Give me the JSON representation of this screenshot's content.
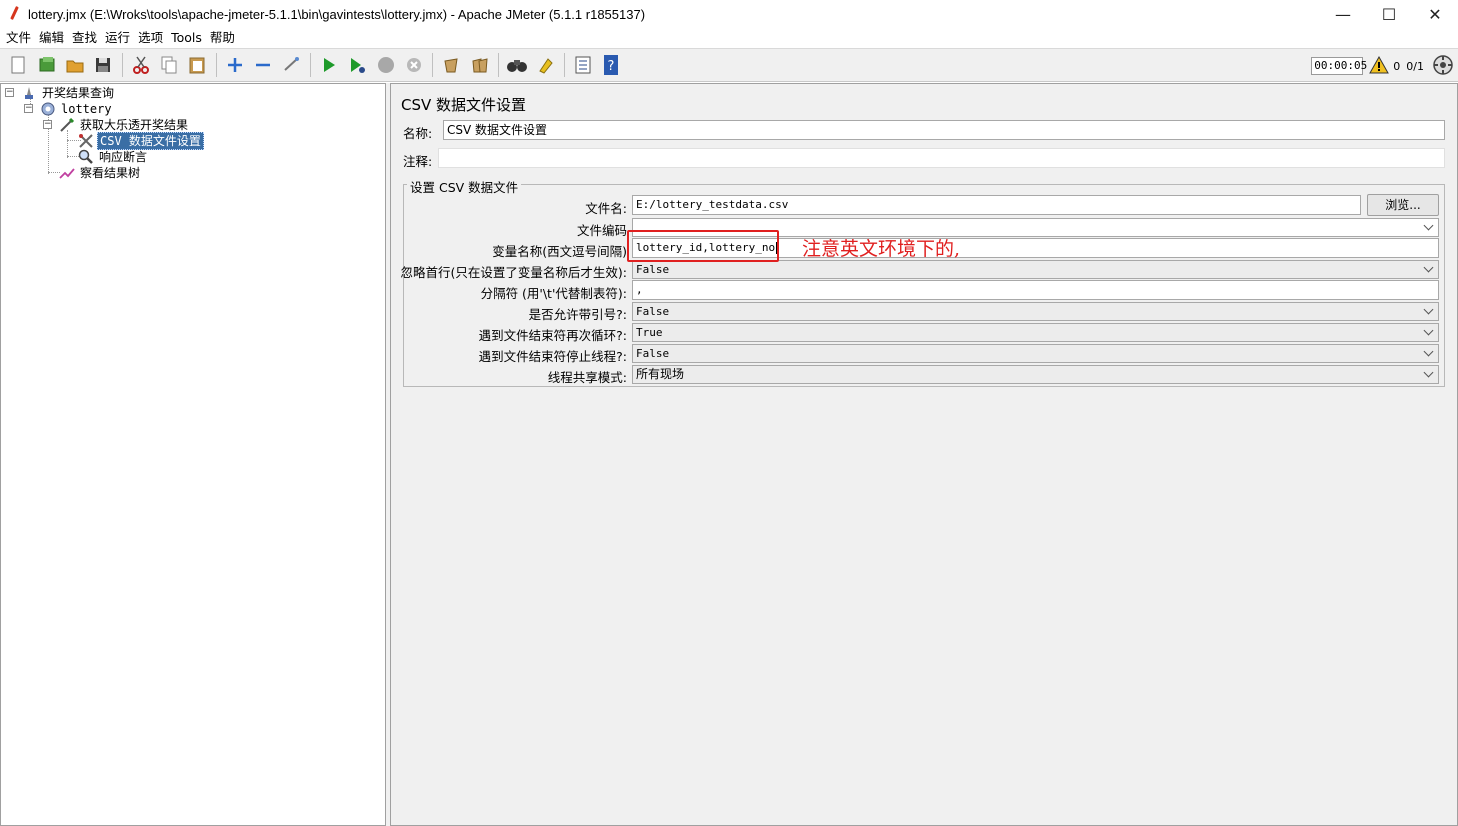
{
  "window": {
    "title": "lottery.jmx (E:\\Wroks\\tools\\apache-jmeter-5.1.1\\bin\\gavintests\\lottery.jmx) - Apache JMeter (5.1.1 r1855137)",
    "minimize": "—",
    "maximize": "☐",
    "close": "✕"
  },
  "menu": [
    "文件",
    "编辑",
    "查找",
    "运行",
    "选项",
    "Tools",
    "帮助"
  ],
  "toolbar": {
    "timer": "00:00:05",
    "warnings": "0",
    "threads": "0/1"
  },
  "tree": {
    "nodes": [
      {
        "label": "开奖结果查询"
      },
      {
        "label": "lottery"
      },
      {
        "label": "获取大乐透开奖结果"
      },
      {
        "label": "CSV 数据文件设置"
      },
      {
        "label": "响应断言"
      },
      {
        "label": "察看结果树"
      }
    ]
  },
  "panel": {
    "title": "CSV 数据文件设置",
    "name_label": "名称:",
    "name_value": "CSV 数据文件设置",
    "comment_label": "注释:",
    "comment_value": "",
    "group_title": "设置 CSV 数据文件",
    "browse_button": "浏览...",
    "fields": {
      "filename_label": "文件名:",
      "filename_value": "E:/lottery_testdata.csv",
      "encoding_label": "文件编码",
      "encoding_value": "",
      "varnames_label": "变量名称(西文逗号间隔)",
      "varnames_value": "lottery_id,lottery_no",
      "ignore_first_label": "忽略首行(只在设置了变量名称后才生效):",
      "ignore_first_value": "False",
      "delimiter_label": "分隔符 (用'\\t'代替制表符):",
      "delimiter_value": ",",
      "quoted_label": "是否允许带引号?:",
      "quoted_value": "False",
      "recycle_label": "遇到文件结束符再次循环?:",
      "recycle_value": "True",
      "stop_label": "遇到文件结束符停止线程?:",
      "stop_value": "False",
      "share_label": "线程共享模式:",
      "share_value": "所有现场"
    }
  },
  "annotation": {
    "text": "注意英文环境下的,",
    "color": "#e02020"
  }
}
